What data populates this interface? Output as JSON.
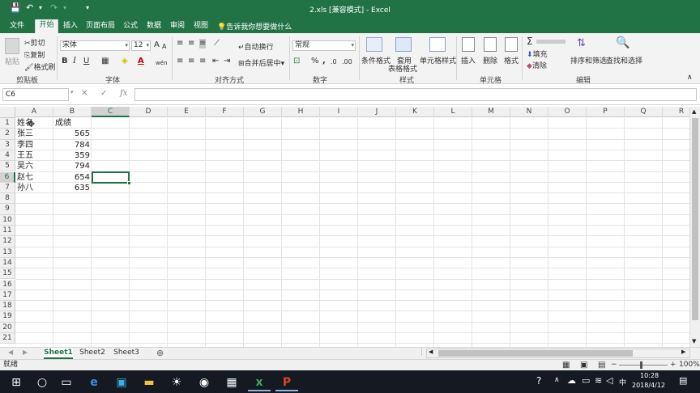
{
  "window": {
    "title": "2.xls [兼容模式] - Excel"
  },
  "qat": {
    "save": "💾",
    "undo": "↶",
    "redo": "↷",
    "more": "▾"
  },
  "tabs": [
    "文件",
    "开始",
    "插入",
    "页面布局",
    "公式",
    "数据",
    "审阅",
    "视图"
  ],
  "active_tab": "开始",
  "tellme": "告诉我你想要做什么",
  "ribbon": {
    "clipboard": {
      "paste": "粘贴",
      "cut": "剪切",
      "copy": "复制",
      "painter": "格式刷",
      "group": "剪贴板"
    },
    "font": {
      "name": "宋体",
      "size": "12",
      "bold": "B",
      "italic": "I",
      "underline": "U",
      "group": "字体",
      "grow": "A",
      "shrink": "A",
      "color_a": "A",
      "phonetic": "wén"
    },
    "align": {
      "wrap": "自动换行",
      "merge": "合并后居中",
      "group": "对齐方式"
    },
    "number": {
      "format": "常规",
      "group": "数字",
      "percent": "%",
      "comma": ","
    },
    "styles": {
      "cond": "条件格式",
      "table1": "套用",
      "table2": "表格格式",
      "cell": "单元格样式",
      "group": "样式"
    },
    "cells": {
      "insert": "插入",
      "delete": "删除",
      "format": "格式",
      "group": "单元格"
    },
    "editing": {
      "sum": "Σ",
      "fill": "填充",
      "clear": "清除",
      "sort": "排序和筛选",
      "find": "查找和选择",
      "group": "编辑"
    }
  },
  "formula": {
    "namebox": "C6",
    "fx": "fx",
    "cancel": "✕",
    "enter": "✓",
    "value": ""
  },
  "sheet": {
    "columns": [
      "A",
      "B",
      "C",
      "D",
      "E",
      "F",
      "G",
      "H",
      "I",
      "J",
      "K",
      "L",
      "M",
      "N",
      "O",
      "P",
      "Q",
      "R"
    ],
    "selected_col": "C",
    "rows": [
      "1",
      "2",
      "3",
      "4",
      "5",
      "6",
      "7",
      "8",
      "9",
      "10",
      "11",
      "12",
      "13",
      "14",
      "15",
      "16",
      "17",
      "18",
      "19",
      "20",
      "21"
    ],
    "selected_row": "6",
    "headers": {
      "a": "姓名",
      "b": "成绩"
    },
    "data": [
      {
        "name": "张三",
        "score": "565"
      },
      {
        "name": "李四",
        "score": "784"
      },
      {
        "name": "王五",
        "score": "359"
      },
      {
        "name": "吴六",
        "score": "794"
      },
      {
        "name": "赵七",
        "score": "654"
      },
      {
        "name": "孙八",
        "score": "635"
      }
    ]
  },
  "sheets": [
    "Sheet1",
    "Sheet2",
    "Sheet3"
  ],
  "active_sheet": "Sheet1",
  "add_sheet": "⊕",
  "status": {
    "ready": "就绪",
    "zoom": "100%",
    "minus": "−",
    "plus": "+"
  },
  "taskbar": {
    "time": "10:28",
    "date": "2018/4/12",
    "ime": "中"
  }
}
